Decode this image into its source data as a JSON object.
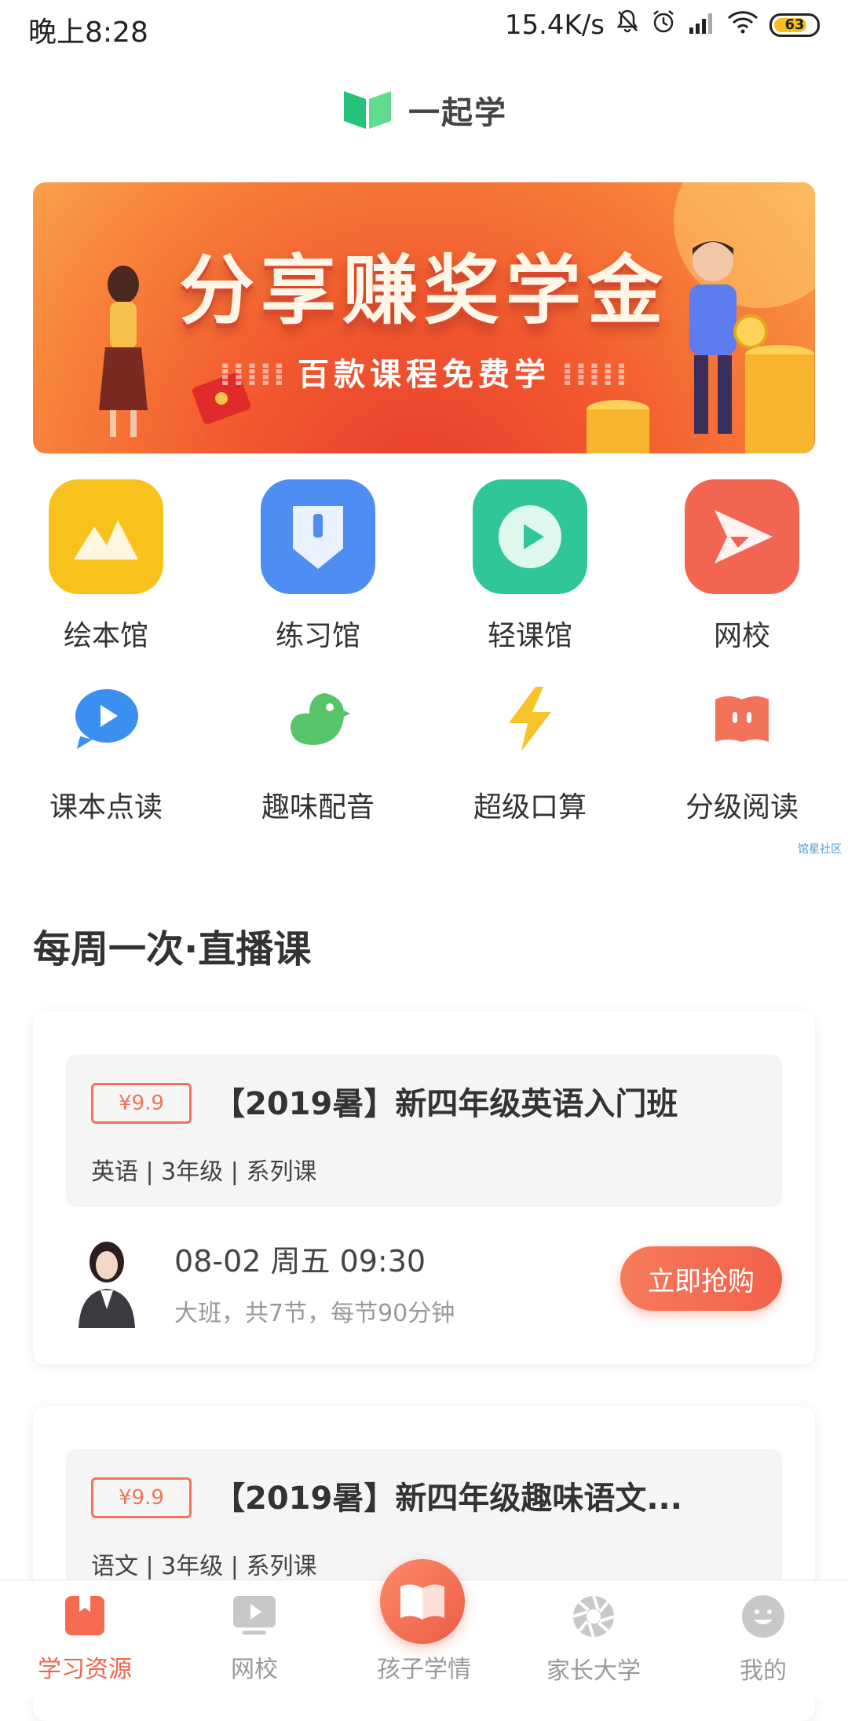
{
  "status_bar": {
    "time": "晚上8:28",
    "speed": "15.4K/s",
    "battery": "63"
  },
  "header": {
    "app_name": "一起学"
  },
  "banner": {
    "title": "分享赚奖学金",
    "subtitle": "百款课程免费学"
  },
  "features_primary": [
    {
      "label": "绘本馆",
      "color": "#f7c21c"
    },
    {
      "label": "练习馆",
      "color": "#4e8df2"
    },
    {
      "label": "轻课馆",
      "color": "#31c69a"
    },
    {
      "label": "网校",
      "color": "#f16552"
    }
  ],
  "features_secondary": [
    {
      "label": "课本点读",
      "color": "#3b8ff0"
    },
    {
      "label": "趣味配音",
      "color": "#58c46a"
    },
    {
      "label": "超级口算",
      "color": "#f8c22a"
    },
    {
      "label": "分级阅读",
      "color": "#f2725a"
    }
  ],
  "watermark": "馆星社区",
  "section": {
    "title": "每周一次·直播课"
  },
  "courses": [
    {
      "price": "¥9.9",
      "title": "【2019暑】新四年级英语入门班",
      "tags": "英语 | 3年级 | 系列课",
      "date": "08-02 周五 09:30",
      "detail": "大班，共7节，每节90分钟",
      "button": "立即抢购"
    },
    {
      "price": "¥9.9",
      "title": "【2019暑】新四年级趣味语文...",
      "tags": "语文 | 3年级 | 系列课"
    }
  ],
  "nav": {
    "items": [
      "学习资源",
      "网校",
      "孩子学情",
      "家长大学",
      "我的"
    ],
    "active_color": "#f0654b"
  }
}
